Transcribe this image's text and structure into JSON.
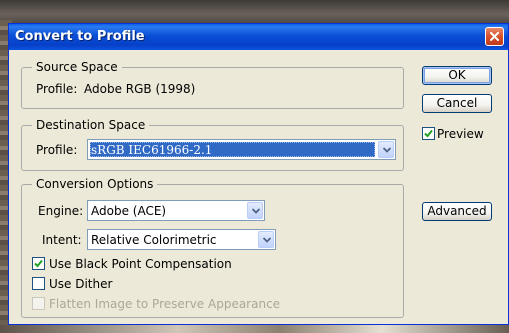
{
  "window": {
    "title": "Convert to Profile"
  },
  "source_space": {
    "legend": "Source Space",
    "profile_label": "Profile:",
    "profile_value": "Adobe RGB (1998)"
  },
  "destination_space": {
    "legend": "Destination Space",
    "profile_label": "Profile:",
    "profile_selected": "sRGB IEC61966-2.1"
  },
  "conversion_options": {
    "legend": "Conversion Options",
    "engine_label": "Engine:",
    "engine_selected": "Adobe (ACE)",
    "intent_label": "Intent:",
    "intent_selected": "Relative Colorimetric",
    "black_point": {
      "label": "Use Black Point Compensation",
      "checked": true
    },
    "dither": {
      "label": "Use Dither",
      "checked": false
    },
    "flatten": {
      "label": "Flatten Image to Preserve Appearance",
      "checked": false,
      "enabled": false
    }
  },
  "buttons": {
    "ok": "OK",
    "cancel": "Cancel",
    "advanced": "Advanced"
  },
  "preview": {
    "label": "Preview",
    "checked": true
  },
  "colors": {
    "title_bar": "#0a4fd6",
    "selection": "#316ac5",
    "dialog_bg": "#ece9d8"
  },
  "icons": {
    "close": "close-icon",
    "dropdown": "chevron-down-icon",
    "check": "checkmark-icon"
  }
}
